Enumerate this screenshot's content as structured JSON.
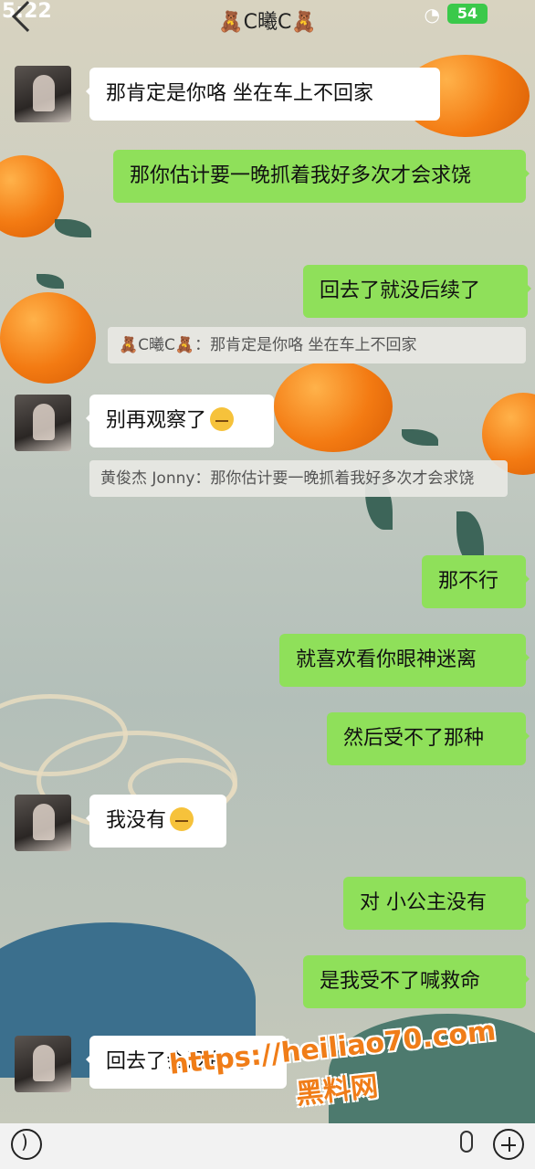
{
  "status": {
    "time": "5:22",
    "battery": "54"
  },
  "chat": {
    "title": "🧸C曦C🧸"
  },
  "messages": [
    {
      "side": "left",
      "text": "那肯定是你咯 坐在车上不回家"
    },
    {
      "side": "right",
      "text": "那你估计要一晚抓着我好多次才会求饶"
    },
    {
      "side": "right",
      "text": "回去了就没后续了"
    },
    {
      "quote": "🧸C曦C🧸：那肯定是你咯 坐在车上不回家"
    },
    {
      "side": "left",
      "text": "别再观察了"
    },
    {
      "quote": "黄俊杰 Jonny：那你估计要一晚抓着我好多次才会求饶"
    },
    {
      "side": "right",
      "text": "那不行"
    },
    {
      "side": "right",
      "text": "就喜欢看你眼神迷离"
    },
    {
      "side": "right",
      "text": "然后受不了那种"
    },
    {
      "side": "left",
      "text": "我没有"
    },
    {
      "side": "right",
      "text": "对 小公主没有"
    },
    {
      "side": "right",
      "text": "是我受不了喊救命"
    },
    {
      "side": "left",
      "text": "回去了会没有吗"
    }
  ],
  "watermark": {
    "url": "https://heiliao70.com",
    "name": "黑料网"
  },
  "icons": [
    "back-icon",
    "wifi-icon",
    "battery-icon",
    "voice-icon",
    "mic-icon",
    "plus-icon",
    "emoji-icon"
  ]
}
